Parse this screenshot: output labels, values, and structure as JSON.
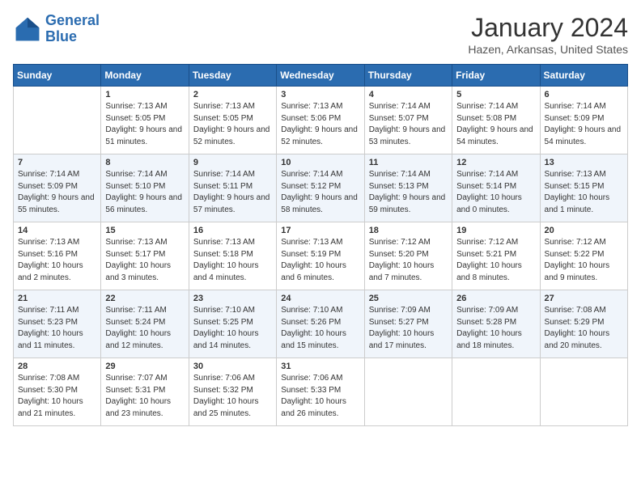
{
  "header": {
    "logo_line1": "General",
    "logo_line2": "Blue",
    "month_title": "January 2024",
    "location": "Hazen, Arkansas, United States"
  },
  "weekdays": [
    "Sunday",
    "Monday",
    "Tuesday",
    "Wednesday",
    "Thursday",
    "Friday",
    "Saturday"
  ],
  "weeks": [
    [
      {
        "day": "",
        "sunrise": "",
        "sunset": "",
        "daylight": ""
      },
      {
        "day": "1",
        "sunrise": "Sunrise: 7:13 AM",
        "sunset": "Sunset: 5:05 PM",
        "daylight": "Daylight: 9 hours and 51 minutes."
      },
      {
        "day": "2",
        "sunrise": "Sunrise: 7:13 AM",
        "sunset": "Sunset: 5:05 PM",
        "daylight": "Daylight: 9 hours and 52 minutes."
      },
      {
        "day": "3",
        "sunrise": "Sunrise: 7:13 AM",
        "sunset": "Sunset: 5:06 PM",
        "daylight": "Daylight: 9 hours and 52 minutes."
      },
      {
        "day": "4",
        "sunrise": "Sunrise: 7:14 AM",
        "sunset": "Sunset: 5:07 PM",
        "daylight": "Daylight: 9 hours and 53 minutes."
      },
      {
        "day": "5",
        "sunrise": "Sunrise: 7:14 AM",
        "sunset": "Sunset: 5:08 PM",
        "daylight": "Daylight: 9 hours and 54 minutes."
      },
      {
        "day": "6",
        "sunrise": "Sunrise: 7:14 AM",
        "sunset": "Sunset: 5:09 PM",
        "daylight": "Daylight: 9 hours and 54 minutes."
      }
    ],
    [
      {
        "day": "7",
        "sunrise": "Sunrise: 7:14 AM",
        "sunset": "Sunset: 5:09 PM",
        "daylight": "Daylight: 9 hours and 55 minutes."
      },
      {
        "day": "8",
        "sunrise": "Sunrise: 7:14 AM",
        "sunset": "Sunset: 5:10 PM",
        "daylight": "Daylight: 9 hours and 56 minutes."
      },
      {
        "day": "9",
        "sunrise": "Sunrise: 7:14 AM",
        "sunset": "Sunset: 5:11 PM",
        "daylight": "Daylight: 9 hours and 57 minutes."
      },
      {
        "day": "10",
        "sunrise": "Sunrise: 7:14 AM",
        "sunset": "Sunset: 5:12 PM",
        "daylight": "Daylight: 9 hours and 58 minutes."
      },
      {
        "day": "11",
        "sunrise": "Sunrise: 7:14 AM",
        "sunset": "Sunset: 5:13 PM",
        "daylight": "Daylight: 9 hours and 59 minutes."
      },
      {
        "day": "12",
        "sunrise": "Sunrise: 7:14 AM",
        "sunset": "Sunset: 5:14 PM",
        "daylight": "Daylight: 10 hours and 0 minutes."
      },
      {
        "day": "13",
        "sunrise": "Sunrise: 7:13 AM",
        "sunset": "Sunset: 5:15 PM",
        "daylight": "Daylight: 10 hours and 1 minute."
      }
    ],
    [
      {
        "day": "14",
        "sunrise": "Sunrise: 7:13 AM",
        "sunset": "Sunset: 5:16 PM",
        "daylight": "Daylight: 10 hours and 2 minutes."
      },
      {
        "day": "15",
        "sunrise": "Sunrise: 7:13 AM",
        "sunset": "Sunset: 5:17 PM",
        "daylight": "Daylight: 10 hours and 3 minutes."
      },
      {
        "day": "16",
        "sunrise": "Sunrise: 7:13 AM",
        "sunset": "Sunset: 5:18 PM",
        "daylight": "Daylight: 10 hours and 4 minutes."
      },
      {
        "day": "17",
        "sunrise": "Sunrise: 7:13 AM",
        "sunset": "Sunset: 5:19 PM",
        "daylight": "Daylight: 10 hours and 6 minutes."
      },
      {
        "day": "18",
        "sunrise": "Sunrise: 7:12 AM",
        "sunset": "Sunset: 5:20 PM",
        "daylight": "Daylight: 10 hours and 7 minutes."
      },
      {
        "day": "19",
        "sunrise": "Sunrise: 7:12 AM",
        "sunset": "Sunset: 5:21 PM",
        "daylight": "Daylight: 10 hours and 8 minutes."
      },
      {
        "day": "20",
        "sunrise": "Sunrise: 7:12 AM",
        "sunset": "Sunset: 5:22 PM",
        "daylight": "Daylight: 10 hours and 9 minutes."
      }
    ],
    [
      {
        "day": "21",
        "sunrise": "Sunrise: 7:11 AM",
        "sunset": "Sunset: 5:23 PM",
        "daylight": "Daylight: 10 hours and 11 minutes."
      },
      {
        "day": "22",
        "sunrise": "Sunrise: 7:11 AM",
        "sunset": "Sunset: 5:24 PM",
        "daylight": "Daylight: 10 hours and 12 minutes."
      },
      {
        "day": "23",
        "sunrise": "Sunrise: 7:10 AM",
        "sunset": "Sunset: 5:25 PM",
        "daylight": "Daylight: 10 hours and 14 minutes."
      },
      {
        "day": "24",
        "sunrise": "Sunrise: 7:10 AM",
        "sunset": "Sunset: 5:26 PM",
        "daylight": "Daylight: 10 hours and 15 minutes."
      },
      {
        "day": "25",
        "sunrise": "Sunrise: 7:09 AM",
        "sunset": "Sunset: 5:27 PM",
        "daylight": "Daylight: 10 hours and 17 minutes."
      },
      {
        "day": "26",
        "sunrise": "Sunrise: 7:09 AM",
        "sunset": "Sunset: 5:28 PM",
        "daylight": "Daylight: 10 hours and 18 minutes."
      },
      {
        "day": "27",
        "sunrise": "Sunrise: 7:08 AM",
        "sunset": "Sunset: 5:29 PM",
        "daylight": "Daylight: 10 hours and 20 minutes."
      }
    ],
    [
      {
        "day": "28",
        "sunrise": "Sunrise: 7:08 AM",
        "sunset": "Sunset: 5:30 PM",
        "daylight": "Daylight: 10 hours and 21 minutes."
      },
      {
        "day": "29",
        "sunrise": "Sunrise: 7:07 AM",
        "sunset": "Sunset: 5:31 PM",
        "daylight": "Daylight: 10 hours and 23 minutes."
      },
      {
        "day": "30",
        "sunrise": "Sunrise: 7:06 AM",
        "sunset": "Sunset: 5:32 PM",
        "daylight": "Daylight: 10 hours and 25 minutes."
      },
      {
        "day": "31",
        "sunrise": "Sunrise: 7:06 AM",
        "sunset": "Sunset: 5:33 PM",
        "daylight": "Daylight: 10 hours and 26 minutes."
      },
      {
        "day": "",
        "sunrise": "",
        "sunset": "",
        "daylight": ""
      },
      {
        "day": "",
        "sunrise": "",
        "sunset": "",
        "daylight": ""
      },
      {
        "day": "",
        "sunrise": "",
        "sunset": "",
        "daylight": ""
      }
    ]
  ]
}
